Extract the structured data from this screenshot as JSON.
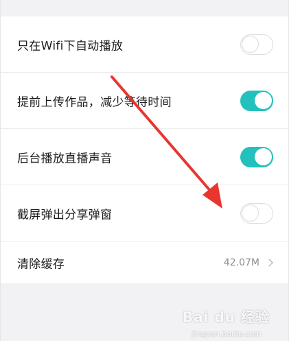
{
  "settings": {
    "rows": [
      {
        "label": "只在Wifi下自动播放",
        "toggle": "off"
      },
      {
        "label": "提前上传作品，减少等待时间",
        "toggle": "on"
      },
      {
        "label": "后台播放直播声音",
        "toggle": "on"
      },
      {
        "label": "截屏弹出分享弹窗",
        "toggle": "off"
      }
    ],
    "cache": {
      "label": "清除缓存",
      "value": "42.07M"
    }
  },
  "colors": {
    "toggle_on": "#22c1bd",
    "annotation_arrow": "#e8362f"
  },
  "watermark": {
    "logo": "Bai du 经验",
    "url": "jingyan.baidu.com"
  }
}
